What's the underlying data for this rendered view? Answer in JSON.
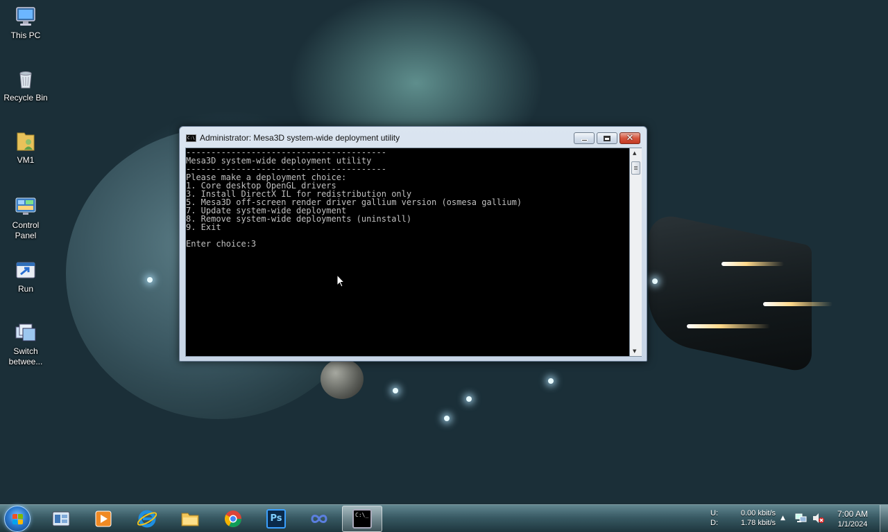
{
  "desktop": {
    "icons": [
      {
        "label": "This PC",
        "icon": "computer-icon"
      },
      {
        "label": "Recycle Bin",
        "icon": "recycle-bin-icon"
      },
      {
        "label": "VM1",
        "icon": "user-folder-icon"
      },
      {
        "label": "Control Panel",
        "icon": "control-panel-icon"
      },
      {
        "label": "Run",
        "icon": "run-icon"
      },
      {
        "label": "Switch betwee...",
        "icon": "switch-windows-icon"
      }
    ]
  },
  "window": {
    "title": "Administrator:  Mesa3D system-wide deployment utility",
    "icon": "cmd-icon",
    "console_text": "----------------------------------------\nMesa3D system-wide deployment utility\n----------------------------------------\nPlease make a deployment choice:\n1. Core desktop OpenGL drivers\n3. Install DirectX IL for redistribution only\n5. Mesa3D off-screen render driver gallium version (osmesa gallium)\n7. Update system-wide deployment\n8. Remove system-wide deployments (uninstall)\n9. Exit\n\nEnter choice:3",
    "minimize_icon": "minimize-icon",
    "maximize_icon": "maximize-icon",
    "close_label": "✕"
  },
  "taskbar": {
    "apps": [
      {
        "name": "Windows Explorer",
        "icon": "explorer-icon"
      },
      {
        "name": "Media Player",
        "icon": "media-player-icon"
      },
      {
        "name": "Internet Explorer",
        "icon": "internet-explorer-icon"
      },
      {
        "name": "File Explorer",
        "icon": "folder-icon"
      },
      {
        "name": "Google Chrome",
        "icon": "chrome-icon"
      },
      {
        "name": "Photoshop",
        "icon": "photoshop-icon",
        "text": "Ps"
      },
      {
        "name": "Visual Studio",
        "icon": "infinity-icon"
      },
      {
        "name": "Command Prompt",
        "icon": "cmd-icon",
        "text": "C:\\_",
        "active": true
      }
    ],
    "net_labels": {
      "upload_label": "U:",
      "download_label": "D:"
    },
    "net_values": {
      "upload": "0.00 kbit/s",
      "download": "1.78 kbit/s"
    },
    "clock": {
      "time": "7:00 AM",
      "date": "1/1/2024"
    },
    "tray_icons": [
      "show-hidden-icons-arrow",
      "network-icon",
      "volume-muted-icon"
    ]
  },
  "colors": {
    "console_bg": "#000000",
    "console_text": "#c0c0c0",
    "close_button": "#c9452c"
  }
}
